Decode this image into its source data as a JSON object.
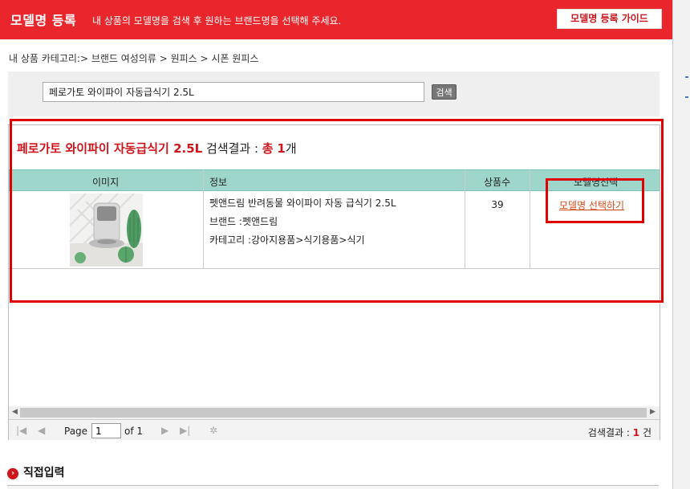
{
  "header": {
    "title": "모델명 등록",
    "description": "내 상품의 모델명을 검색 후 원하는 브랜드명을 선택해 주세요.",
    "guide_button": "모델명 등록 가이드"
  },
  "breadcrumb": "내 상품 카테고리:> 브랜드 여성의류 > 원피스 > 시폰 원피스",
  "search": {
    "value": "페로가토 와이파이 자동급식기 2.5L",
    "button_label": "검색"
  },
  "results": {
    "keyword": "페로가토 와이파이 자동급식기 2.5L",
    "label": "검색결과 :",
    "total_prefix": "총",
    "total_count": "1",
    "total_suffix": "개",
    "columns": [
      "이미지",
      "정보",
      "상품수",
      "모델명선택"
    ],
    "rows": [
      {
        "name": "펫앤드림 반려동물 와이파이 자동 급식기 2.5L",
        "brand": "브랜드 :펫앤드림",
        "category": "카테고리 :강아지용품>식기용품>식기",
        "count": "39",
        "select_label": "모델명 선택하기"
      }
    ]
  },
  "pager": {
    "page_label": "Page",
    "page_value": "1",
    "of_label": "of 1",
    "summary_label": "검색결과 :",
    "summary_count": "1",
    "summary_unit": "건"
  },
  "direct_input": {
    "title": "직접입력"
  },
  "colors": {
    "header_bg": "#e8262c",
    "grid_header_bg": "#9fd6cc",
    "highlight": "#e00000",
    "link": "#d44a17"
  }
}
